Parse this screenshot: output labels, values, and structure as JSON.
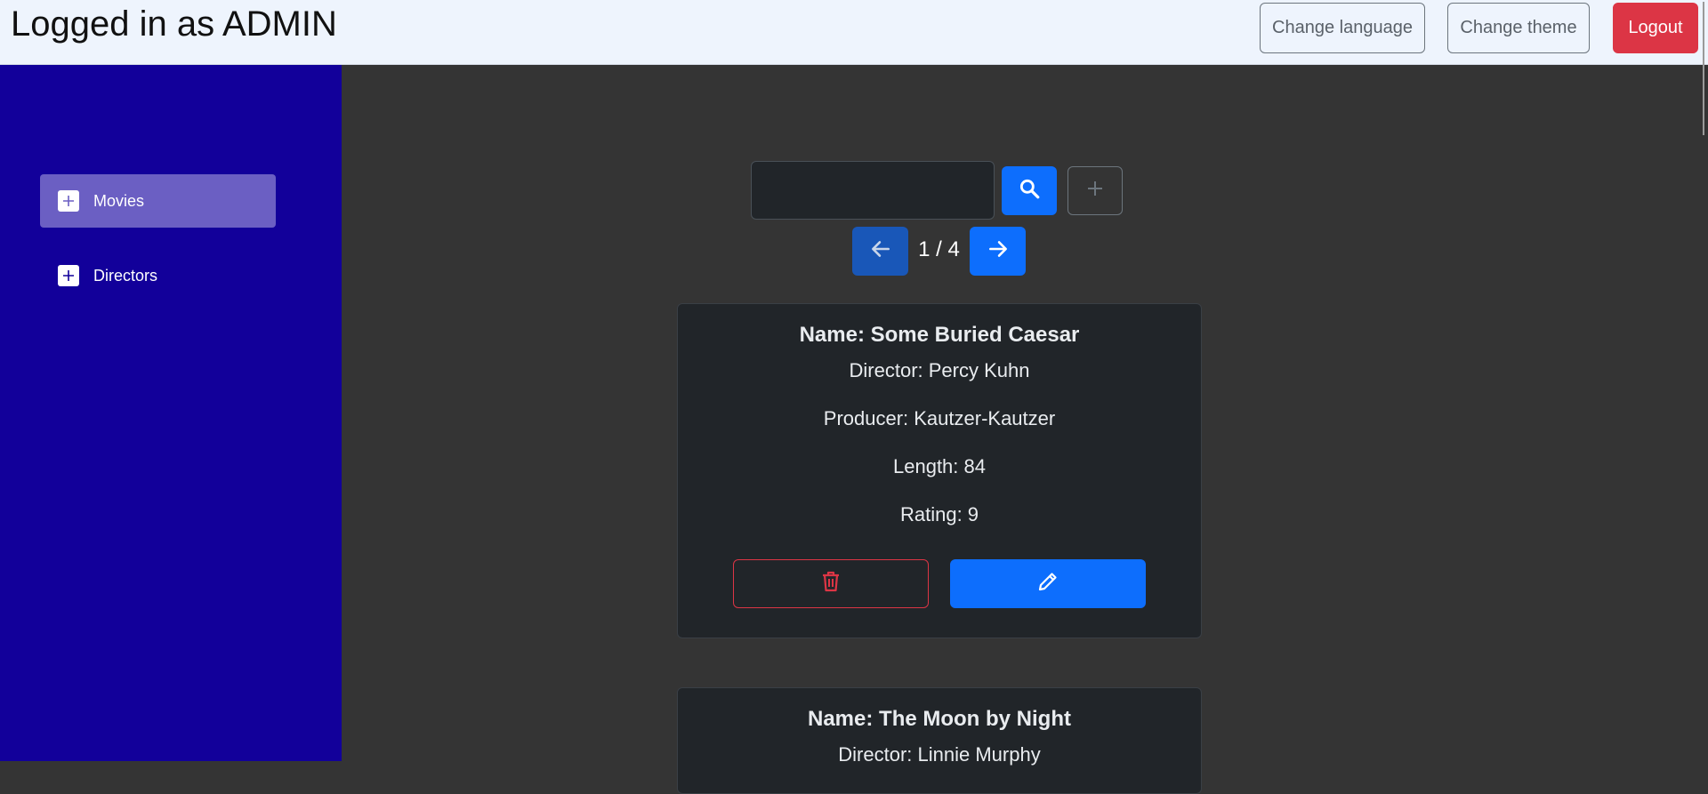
{
  "header": {
    "title": "Logged in as ADMIN",
    "change_language_label": "Change language",
    "change_theme_label": "Change theme",
    "logout_label": "Logout"
  },
  "sidebar": {
    "items": [
      {
        "label": "Movies",
        "active": true,
        "icon": "plus-icon"
      },
      {
        "label": "Directors",
        "active": false,
        "icon": "plus-icon"
      }
    ]
  },
  "toolbar": {
    "search_value": "",
    "search_icon": "search-icon",
    "add_icon": "plus-icon"
  },
  "pagination": {
    "indicator": "1 / 4",
    "prev_icon": "arrow-left-icon",
    "next_icon": "arrow-right-icon"
  },
  "movies": [
    {
      "name": "Name: Some Buried Caesar",
      "director": "Director: Percy Kuhn",
      "producer": "Producer: Kautzer-Kautzer",
      "length": "Length: 84",
      "rating": "Rating: 9"
    },
    {
      "name": "Name: The Moon by Night",
      "director": "Director: Linnie Murphy"
    }
  ],
  "colors": {
    "header_bg": "#eef4fd",
    "sidebar_bg": "#12009a",
    "sidebar_active": "#6b5fc3",
    "main_bg": "#343434",
    "card_bg": "#212529",
    "primary": "#0d6efd",
    "danger": "#dc3545"
  }
}
